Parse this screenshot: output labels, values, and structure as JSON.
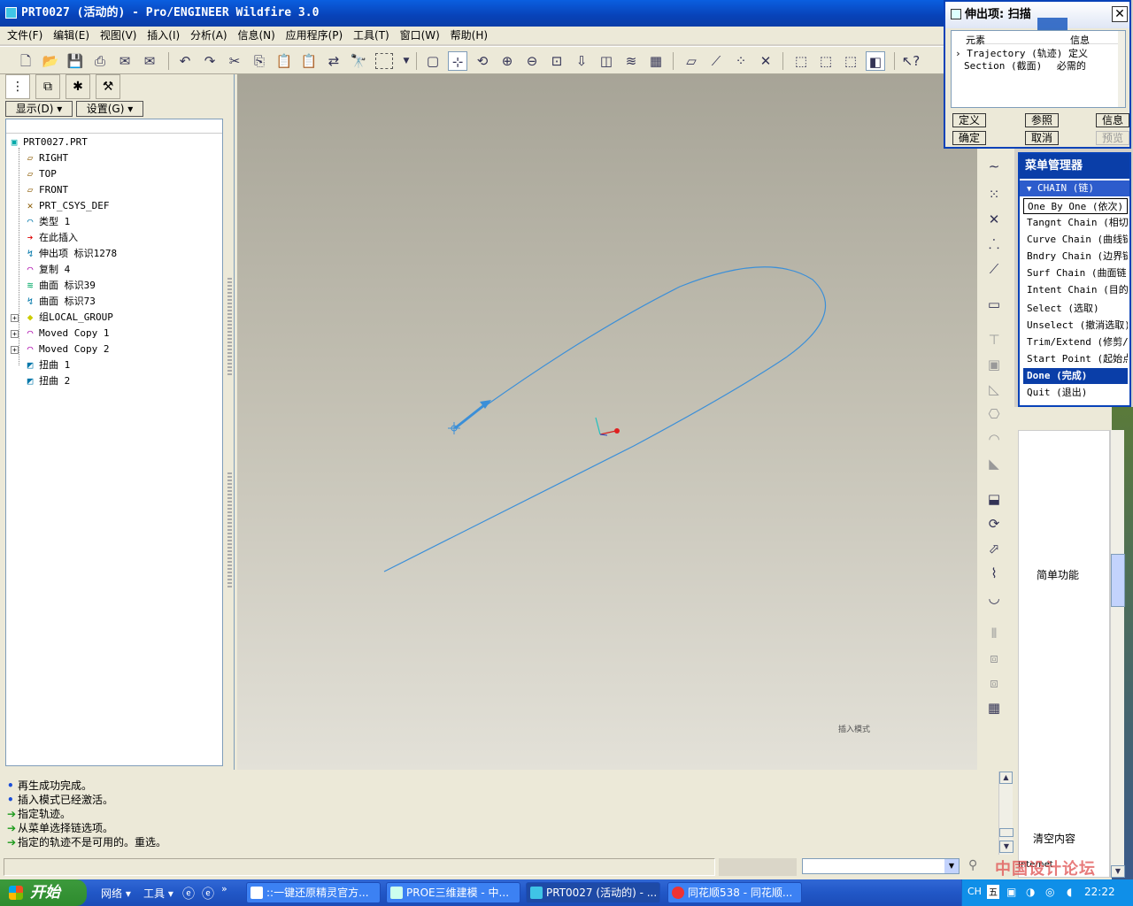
{
  "window": {
    "title": "PRT0027 (活动的) - Pro/ENGINEER Wildfire 3.0"
  },
  "menu": [
    "文件(F)",
    "编辑(E)",
    "视图(V)",
    "插入(I)",
    "分析(A)",
    "信息(N)",
    "应用程序(P)",
    "工具(T)",
    "窗口(W)",
    "帮助(H)"
  ],
  "left": {
    "show_label": "显示(D)",
    "settings_label": "设置(G)",
    "tree": [
      {
        "label": "PRT0027.PRT",
        "icon": "part-icon"
      },
      {
        "label": "RIGHT",
        "icon": "datum-plane-icon"
      },
      {
        "label": "TOP",
        "icon": "datum-plane-icon"
      },
      {
        "label": "FRONT",
        "icon": "datum-plane-icon"
      },
      {
        "label": "PRT_CSYS_DEF",
        "icon": "csys-icon"
      },
      {
        "label": "类型 1",
        "icon": "cosmetic-icon"
      },
      {
        "label": "在此插入",
        "icon": "insert-here-icon"
      },
      {
        "label": "伸出项 标识1278",
        "icon": "protrusion-icon"
      },
      {
        "label": "复制 4",
        "icon": "copy-icon"
      },
      {
        "label": "曲面 标识39",
        "icon": "surface-icon"
      },
      {
        "label": "曲面 标识73",
        "icon": "surface-icon"
      },
      {
        "label": "组LOCAL_GROUP",
        "icon": "group-icon"
      },
      {
        "label": "Moved Copy 1",
        "icon": "moved-copy-icon"
      },
      {
        "label": "Moved Copy 2",
        "icon": "moved-copy-icon"
      },
      {
        "label": "扭曲 1",
        "icon": "warp-icon"
      },
      {
        "label": "扭曲 2",
        "icon": "warp-icon"
      }
    ]
  },
  "viewport": {
    "mode_label": "插入模式"
  },
  "messages": [
    {
      "type": "info",
      "text": "再生成功完成。"
    },
    {
      "type": "info",
      "text": "插入模式已经激活。"
    },
    {
      "type": "prompt",
      "text": "指定轨迹。"
    },
    {
      "type": "prompt",
      "text": "从菜单选择链选项。"
    },
    {
      "type": "prompt",
      "text": "指定的轨迹不是可用的。重选。"
    }
  ],
  "feature_dialog": {
    "title": "伸出项: 扫描",
    "col_element": "元素",
    "col_info": "信息",
    "rows": [
      {
        "element": "Trajectory (轨迹)",
        "info": "定义"
      },
      {
        "element": "Section (截面)",
        "info": "必需的"
      }
    ],
    "buttons": {
      "define": "定义",
      "refs": "参照",
      "info": "信息",
      "ok": "确定",
      "cancel": "取消",
      "preview": "预览"
    }
  },
  "menu_manager": {
    "title": "菜单管理器",
    "section": "CHAIN (链)",
    "items": [
      "One By One (依次)",
      "Tangnt Chain (相切链)",
      "Curve Chain (曲线链)",
      "Bndry Chain (边界链)",
      "Surf Chain (曲面链)",
      "Intent Chain (目的链)",
      "Select (选取)",
      "Unselect (撤消选取)",
      "Trim/Extend (修剪/延伸)",
      "Start Point (起始点)",
      "Done (完成)",
      "Quit (退出)"
    ]
  },
  "browser_side": {
    "simple": "简单功能",
    "clear": "清空内容",
    "internet": "Internet"
  },
  "taskbar": {
    "start": "开始",
    "quick": [
      "网络",
      "工具"
    ],
    "tasks": [
      "::一键还原精灵官方...",
      "PROE三维建模 - 中...",
      "PRT0027 (活动的) - ...",
      "同花顺538 - 同花顺..."
    ],
    "lang": "CH",
    "time": "22:22"
  },
  "watermark": "中国设计论坛"
}
